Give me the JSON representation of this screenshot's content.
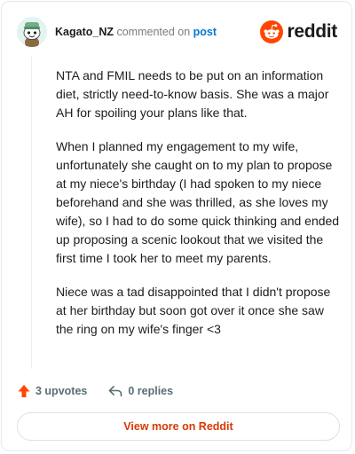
{
  "comment": {
    "author": "Kagato_NZ",
    "action_text": "commented on",
    "post_link_text": "post",
    "paragraphs": [
      "NTA and FMIL needs to be put on an information diet, strictly need-to-know basis. She was a major AH for spoiling your plans like that.",
      "When I planned my engagement to my wife, unfortunately she caught on to my plan to propose at my niece's birthday (I had spoken to my niece beforehand and she was thrilled, as she loves my wife), so I had to do some quick thinking and ended up proposing a scenic lookout that we visited the first time I took her to meet my parents.",
      "Niece was a tad disappointed that I didn't propose at her birthday but soon got over it once she saw the ring on my wife's finger <3"
    ],
    "upvotes_label": "3 upvotes",
    "replies_label": "0 replies"
  },
  "brand": {
    "wordmark": "reddit",
    "color": "#ff4500"
  },
  "view_more_label": "View more on Reddit",
  "colors": {
    "link": "#0079d3",
    "upvote": "#ff4500",
    "view_more_text": "#d93a00",
    "muted": "#7c7c7c"
  },
  "icons": {
    "avatar": "snoo-avatar-icon",
    "brand": "reddit-logo-icon",
    "upvote": "upvote-arrow-icon",
    "reply": "reply-arrow-icon"
  }
}
